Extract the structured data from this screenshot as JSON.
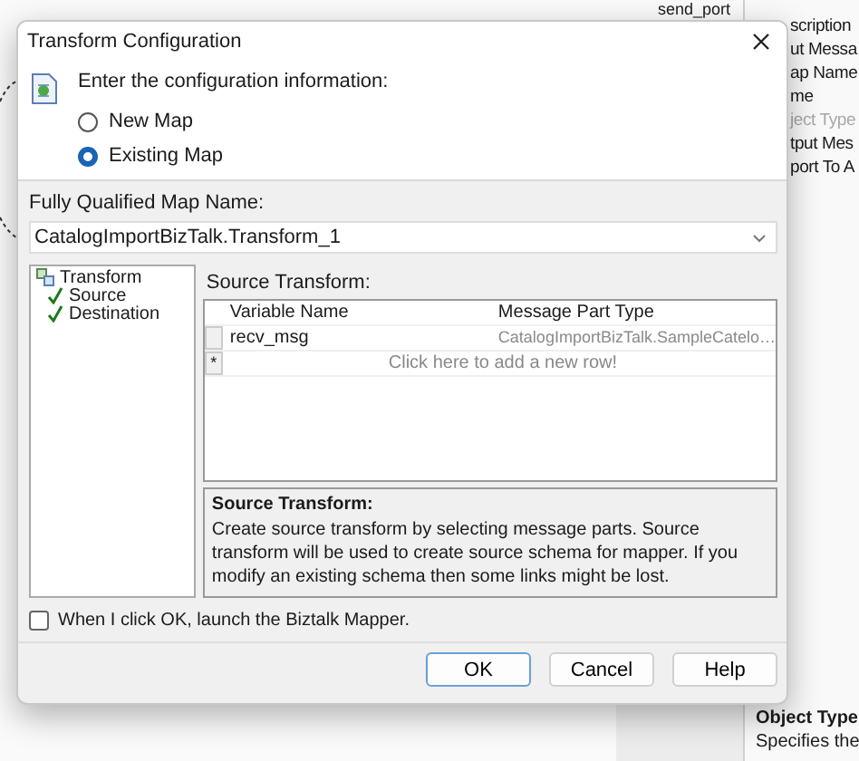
{
  "background": {
    "node_label": "send_port",
    "properties": [
      {
        "name": "scription",
        "disabled": false
      },
      {
        "name": "ut Messa",
        "disabled": false
      },
      {
        "name": "ap Name",
        "disabled": false
      },
      {
        "name": "me",
        "disabled": false
      },
      {
        "name": "ject Type",
        "disabled": true
      },
      {
        "name": "tput Mes",
        "disabled": false
      },
      {
        "name": "port To A",
        "disabled": false
      }
    ],
    "description": {
      "title": "Object Type",
      "text": "Specifies the"
    }
  },
  "dialog": {
    "title": "Transform Configuration",
    "prompt": "Enter the configuration information:",
    "options": [
      {
        "label": "New Map",
        "selected": false
      },
      {
        "label": "Existing Map",
        "selected": true
      }
    ],
    "map_name": {
      "label": "Fully Qualified Map Name:",
      "value": "CatalogImportBizTalk.Transform_1"
    },
    "tree": [
      {
        "label": "Transform",
        "children": [
          {
            "label": "Source",
            "checked": true
          },
          {
            "label": "Destination",
            "checked": true
          }
        ]
      }
    ],
    "grid": {
      "title": "Source Transform:",
      "columns": [
        "Variable Name",
        "Message Part Type"
      ],
      "rows": [
        {
          "variable": "recv_msg",
          "type": "CatalogImportBizTalk.SampleCatelo…"
        }
      ],
      "new_row_marker": "*",
      "new_row": "Click here to add a new row!"
    },
    "info": {
      "title": "Source Transform:",
      "text": "Create source transform by selecting message parts. Source transform will be used to create source schema for mapper. If you modify an existing schema then some links might be lost."
    },
    "launch_mapper": {
      "label": "When I click OK, launch the Biztalk Mapper.",
      "checked": false
    },
    "buttons": [
      {
        "label": "OK",
        "default": true
      },
      {
        "label": "Cancel",
        "default": false
      },
      {
        "label": "Help",
        "default": false
      }
    ]
  }
}
